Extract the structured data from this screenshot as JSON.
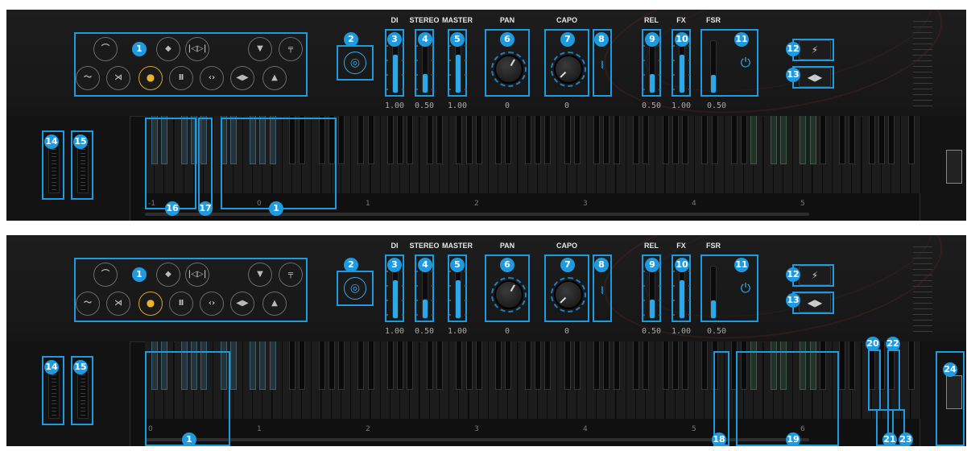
{
  "panels": [
    {
      "params": {
        "di": {
          "label": "DI",
          "value": "1.00",
          "level": 1.0
        },
        "stereo": {
          "label": "STEREO",
          "value": "0.50",
          "level": 0.5
        },
        "master": {
          "label": "MASTER",
          "value": "1.00",
          "level": 1.0
        },
        "pan": {
          "label": "PAN",
          "value": "0"
        },
        "capo": {
          "label": "CAPO",
          "value": "0"
        },
        "rel": {
          "label": "REL",
          "value": "0.50",
          "level": 0.5
        },
        "fx": {
          "label": "FX",
          "value": "1.00",
          "level": 1.0
        },
        "fsr": {
          "label": "FSR",
          "value": "0.50",
          "level": 0.5
        }
      },
      "octaves": [
        "-1",
        "0",
        "1",
        "2",
        "3",
        "4",
        "5"
      ],
      "badges": [
        "1",
        "2",
        "3",
        "4",
        "5",
        "6",
        "7",
        "8",
        "9",
        "10",
        "11",
        "12",
        "13",
        "14",
        "15",
        "16",
        "17",
        "1"
      ]
    },
    {
      "params": {
        "di": {
          "label": "DI",
          "value": "1.00",
          "level": 1.0
        },
        "stereo": {
          "label": "STEREO",
          "value": "0.50",
          "level": 0.5
        },
        "master": {
          "label": "MASTER",
          "value": "1.00",
          "level": 1.0
        },
        "pan": {
          "label": "PAN",
          "value": "0"
        },
        "capo": {
          "label": "CAPO",
          "value": "0"
        },
        "rel": {
          "label": "REL",
          "value": "0.50",
          "level": 0.5
        },
        "fx": {
          "label": "FX",
          "value": "1.00",
          "level": 1.0
        },
        "fsr": {
          "label": "FSR",
          "value": "0.50",
          "level": 0.5
        }
      },
      "octaves": [
        "0",
        "1",
        "2",
        "3",
        "4",
        "5",
        "6"
      ],
      "badges": [
        "1",
        "2",
        "3",
        "4",
        "5",
        "6",
        "7",
        "8",
        "9",
        "10",
        "11",
        "12",
        "13",
        "14",
        "15",
        "1",
        "18",
        "19",
        "20",
        "21",
        "22",
        "23",
        "24"
      ]
    }
  ],
  "transport": {
    "buttons": [
      {
        "name": "wave-button",
        "glyph": "⌒"
      },
      {
        "name": "diamond-button",
        "glyph": "◆"
      },
      {
        "name": "skip-button",
        "glyph": "|◁▷|"
      },
      {
        "name": "triangle-down-button",
        "glyph": "▼"
      },
      {
        "name": "pedal-button",
        "glyph": "╤"
      },
      {
        "name": "squiggle-button",
        "glyph": "〜"
      },
      {
        "name": "merge-button",
        "glyph": "⋊"
      },
      {
        "name": "record-button",
        "glyph": "●"
      },
      {
        "name": "pause-button",
        "glyph": "Ⅱ"
      },
      {
        "name": "expand-button",
        "glyph": "‹›"
      },
      {
        "name": "left-right-button",
        "glyph": "◀▶"
      },
      {
        "name": "triangle-up-button",
        "glyph": "▲"
      }
    ]
  },
  "icons": {
    "stereo_ring": "◎",
    "power": "⏻",
    "guitar": "⚡",
    "arrows": "◀▶"
  },
  "colors": {
    "accent": "#1e9be0",
    "record": "#d8a326",
    "meter": "#2aa8e8"
  }
}
